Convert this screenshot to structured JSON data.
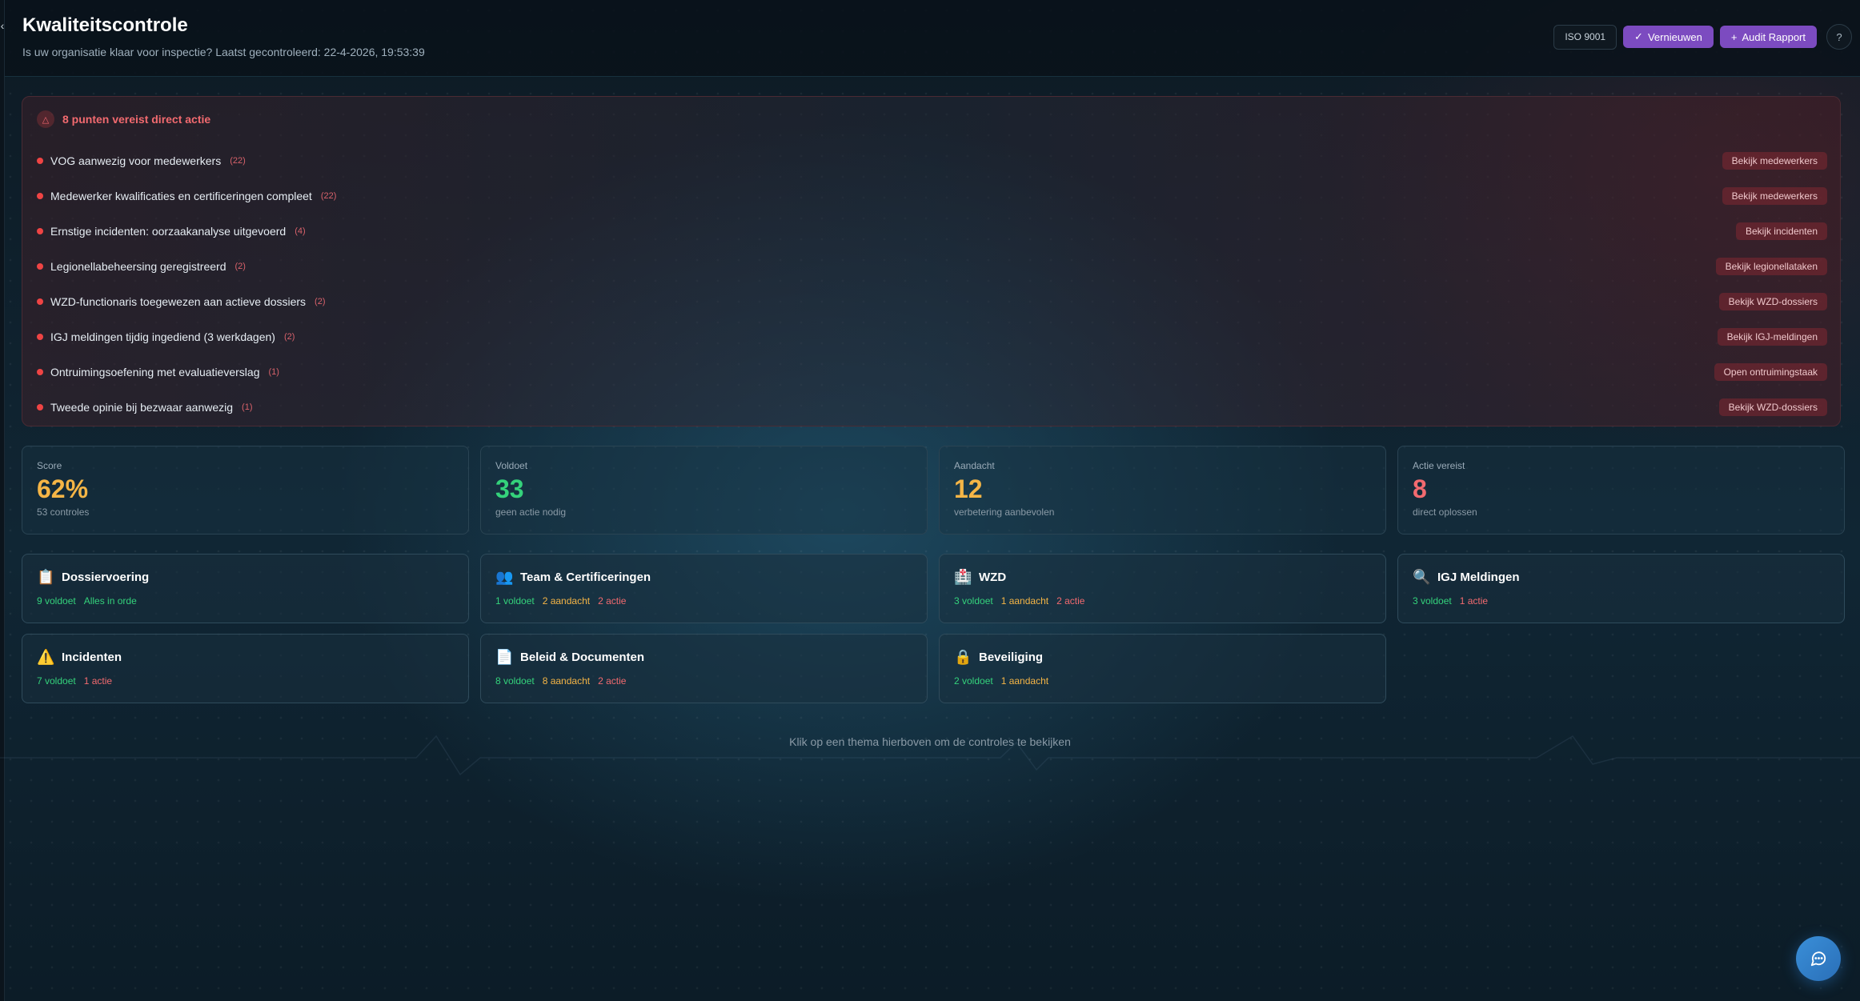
{
  "header": {
    "title": "Kwaliteitscontrole",
    "subtitle": "Is uw organisatie klaar voor inspectie? Laatst gecontroleerd: 22-4-2026, 19:53:39",
    "iso_label": "ISO 9001",
    "refresh_label": "Vernieuwen",
    "audit_label": "Audit Rapport"
  },
  "alert": {
    "title": "8 punten vereist direct actie",
    "items": [
      {
        "label": "VOG aanwezig voor medewerkers",
        "count": "(22)",
        "action": "Bekijk medewerkers"
      },
      {
        "label": "Medewerker kwalificaties en certificeringen compleet",
        "count": "(22)",
        "action": "Bekijk medewerkers"
      },
      {
        "label": "Ernstige incidenten: oorzaakanalyse uitgevoerd",
        "count": "(4)",
        "action": "Bekijk incidenten"
      },
      {
        "label": "Legionellabeheersing geregistreerd",
        "count": "(2)",
        "action": "Bekijk legionellataken"
      },
      {
        "label": "WZD-functionaris toegewezen aan actieve dossiers",
        "count": "(2)",
        "action": "Bekijk WZD-dossiers"
      },
      {
        "label": "IGJ meldingen tijdig ingediend (3 werkdagen)",
        "count": "(2)",
        "action": "Bekijk IGJ-meldingen"
      },
      {
        "label": "Ontruimingsoefening met evaluatieverslag",
        "count": "(1)",
        "action": "Open ontruimingstaak"
      },
      {
        "label": "Tweede opinie bij bezwaar aanwezig",
        "count": "(1)",
        "action": "Bekijk WZD-dossiers"
      }
    ]
  },
  "stats": [
    {
      "label": "Score",
      "value": "62%",
      "sub": "53 controles",
      "color": "#f5b546"
    },
    {
      "label": "Voldoet",
      "value": "33",
      "sub": "geen actie nodig",
      "color": "#34d27b"
    },
    {
      "label": "Aandacht",
      "value": "12",
      "sub": "verbetering aanbevolen",
      "color": "#f5b546"
    },
    {
      "label": "Actie vereist",
      "value": "8",
      "sub": "direct oplossen",
      "color": "#f26a6f"
    }
  ],
  "themes": [
    {
      "icon": "📋",
      "icon_name": "clipboard-icon",
      "title": "Dossiervoering",
      "ok": "9 voldoet",
      "warn": "",
      "act": "",
      "note": "Alles in orde"
    },
    {
      "icon": "👥",
      "icon_name": "people-icon",
      "title": "Team & Certificeringen",
      "ok": "1 voldoet",
      "warn": "2 aandacht",
      "act": "2 actie",
      "note": ""
    },
    {
      "icon": "🏥",
      "icon_name": "hospital-icon",
      "title": "WZD",
      "ok": "3 voldoet",
      "warn": "1 aandacht",
      "act": "2 actie",
      "note": ""
    },
    {
      "icon": "🔍",
      "icon_name": "magnifier-icon",
      "title": "IGJ Meldingen",
      "ok": "3 voldoet",
      "warn": "",
      "act": "1 actie",
      "note": ""
    },
    {
      "icon": "⚠️",
      "icon_name": "warning-icon",
      "title": "Incidenten",
      "ok": "7 voldoet",
      "warn": "",
      "act": "1 actie",
      "note": ""
    },
    {
      "icon": "📄",
      "icon_name": "document-icon",
      "title": "Beleid & Documenten",
      "ok": "8 voldoet",
      "warn": "8 aandacht",
      "act": "2 actie",
      "note": ""
    },
    {
      "icon": "🔒",
      "icon_name": "lock-icon",
      "title": "Beveiliging",
      "ok": "2 voldoet",
      "warn": "1 aandacht",
      "act": "",
      "note": ""
    }
  ],
  "hint": "Klik op een thema hierboven om de controles te bekijken"
}
